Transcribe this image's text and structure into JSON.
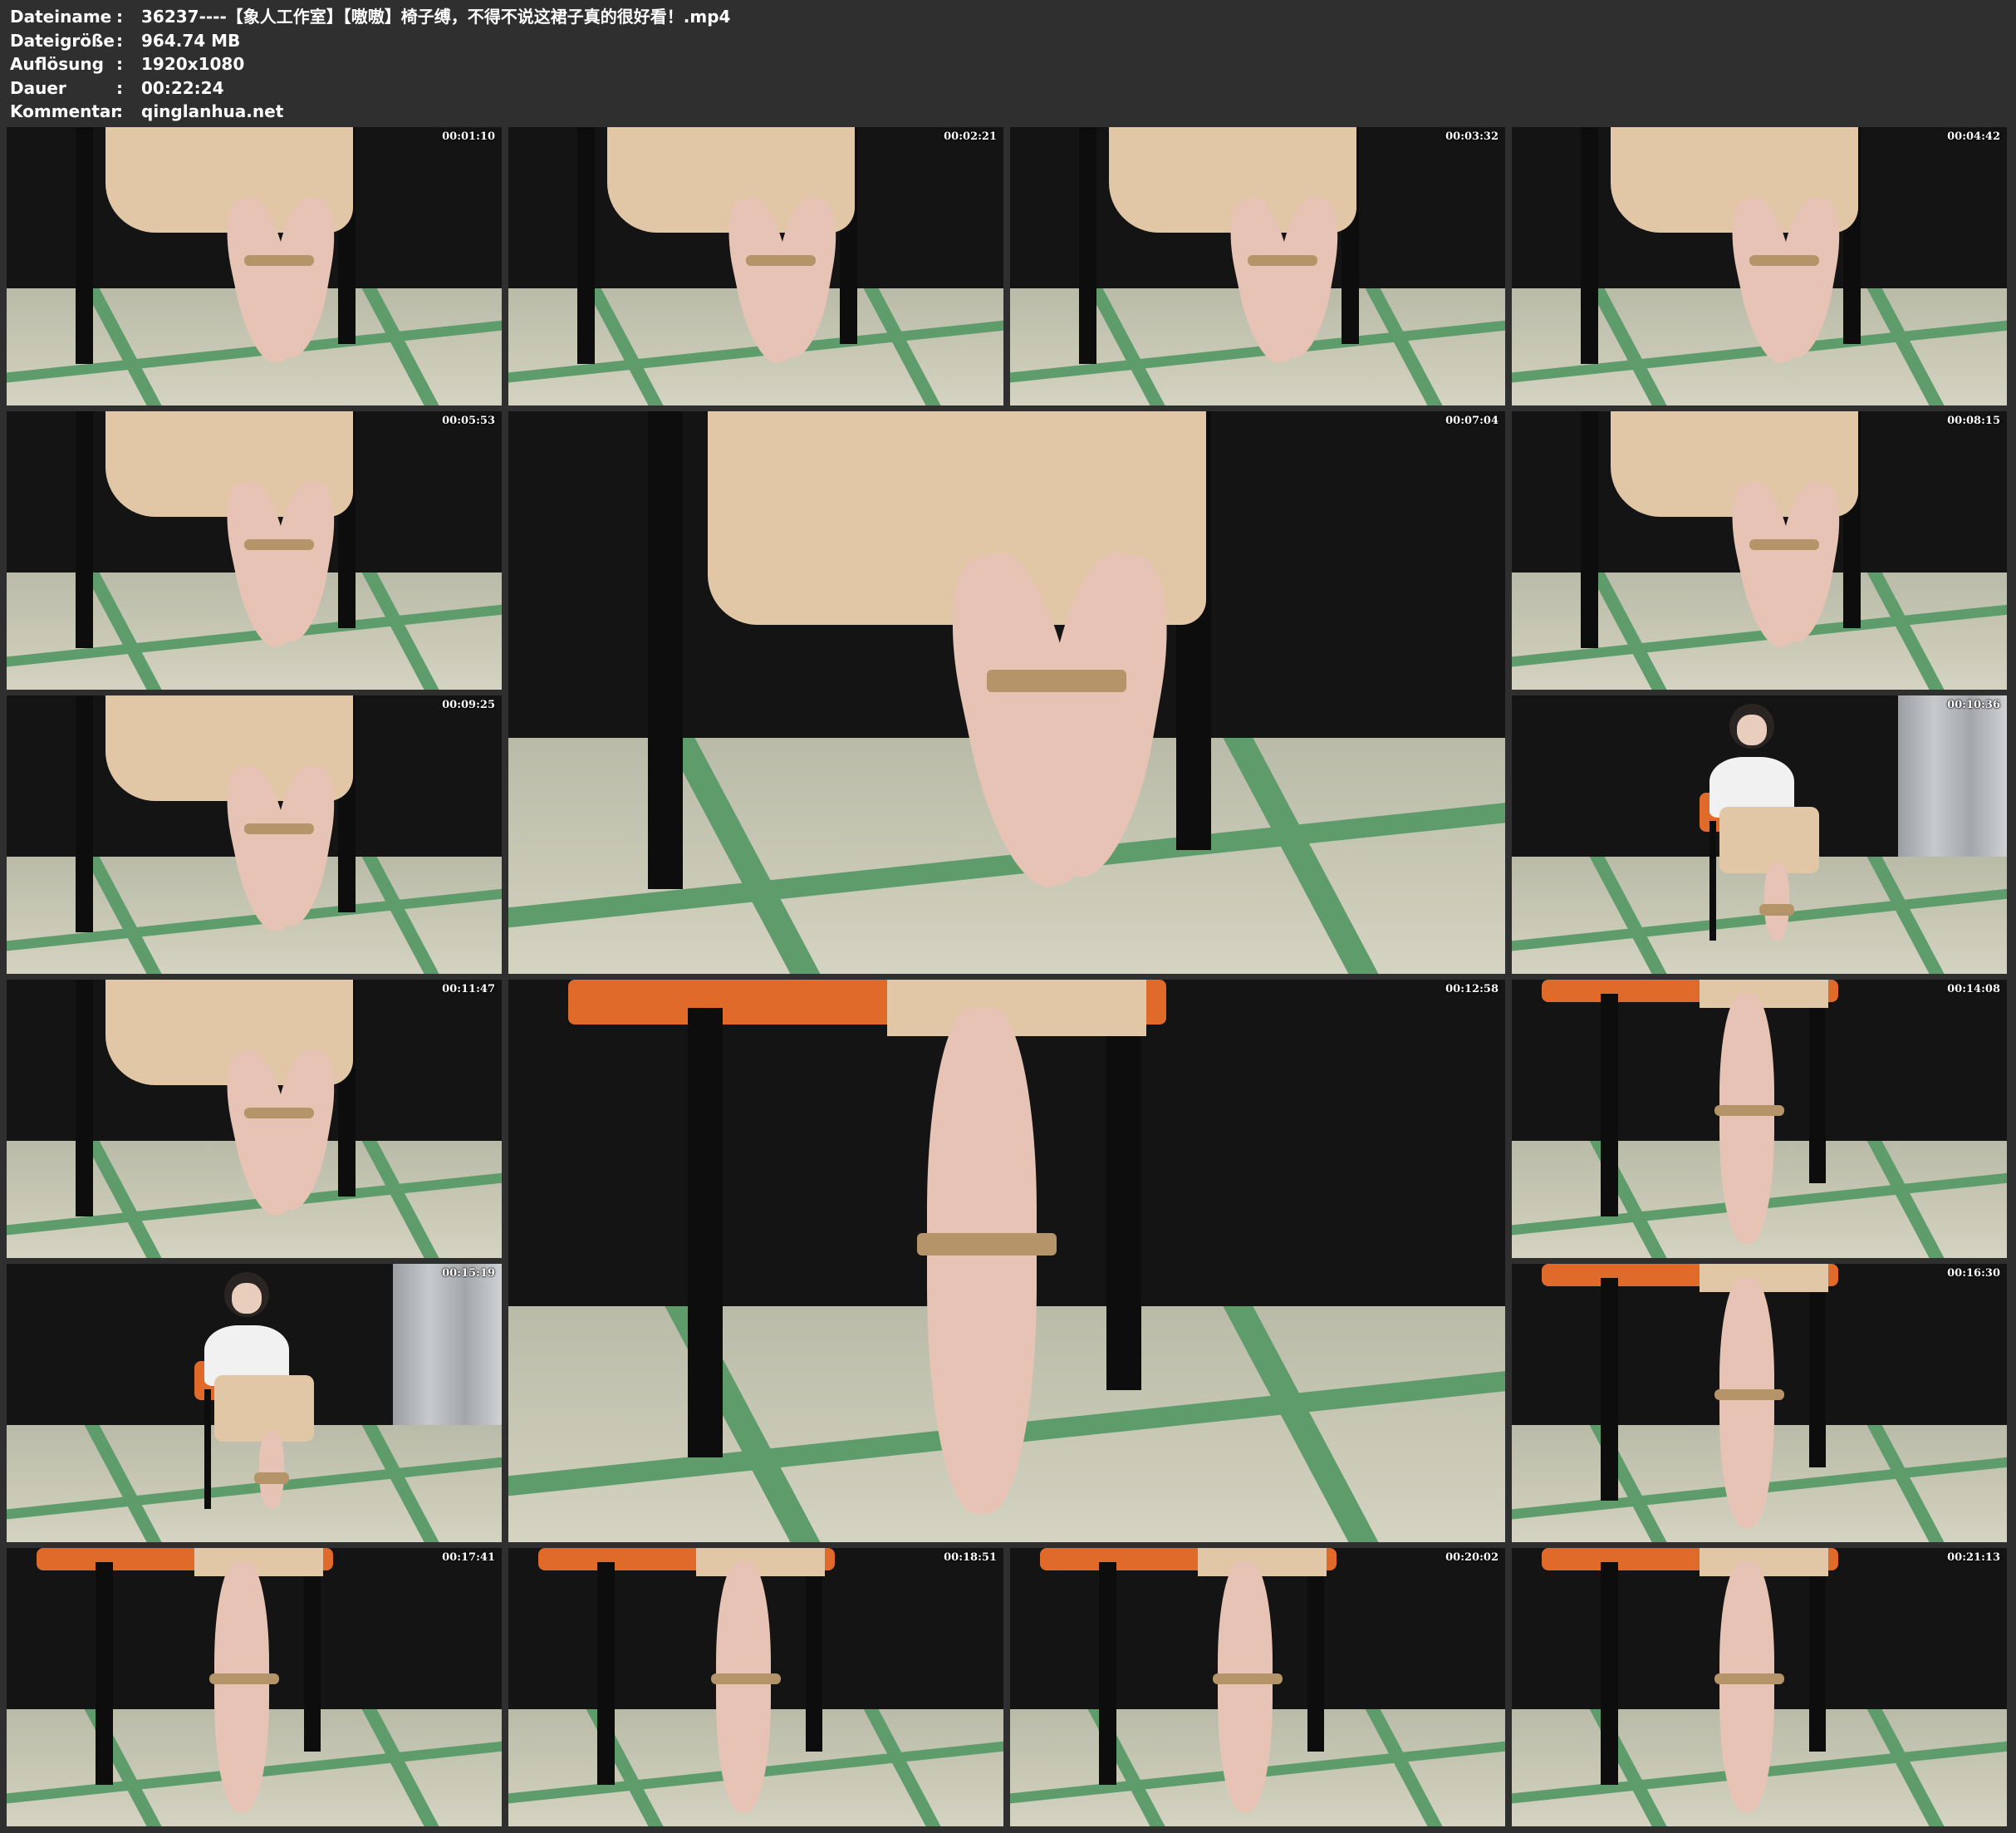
{
  "info": [
    {
      "key": "Dateiname",
      "value": "36237----【象人工作室】【嗷嗷】椅子缚，不得不说这裙子真的很好看！.mp4"
    },
    {
      "key": "Dateigröße",
      "value": "964.74 MB"
    },
    {
      "key": "Auflösung",
      "value": "1920x1080"
    },
    {
      "key": "Dauer",
      "value": "00:22:24"
    },
    {
      "key": "Kommentar",
      "value": "qinglanhua.net"
    }
  ],
  "separator": ":",
  "thumbnails": [
    {
      "timestamp": "00:01:10",
      "scene": "feet-closeup"
    },
    {
      "timestamp": "00:02:21",
      "scene": "feet-closeup"
    },
    {
      "timestamp": "00:03:32",
      "scene": "feet-closeup"
    },
    {
      "timestamp": "00:04:42",
      "scene": "feet-closeup"
    },
    {
      "timestamp": "00:05:53",
      "scene": "feet-closeup"
    },
    {
      "timestamp": "00:07:04",
      "scene": "feet-closeup-large"
    },
    {
      "timestamp": "00:08:15",
      "scene": "feet-closeup"
    },
    {
      "timestamp": "00:09:25",
      "scene": "feet-closeup"
    },
    {
      "timestamp": "00:10:36",
      "scene": "full-body"
    },
    {
      "timestamp": "00:11:47",
      "scene": "feet-closeup"
    },
    {
      "timestamp": "00:12:58",
      "scene": "leg-standing-large"
    },
    {
      "timestamp": "00:14:08",
      "scene": "leg-standing"
    },
    {
      "timestamp": "00:15:19",
      "scene": "full-body"
    },
    {
      "timestamp": "00:16:30",
      "scene": "leg-standing"
    },
    {
      "timestamp": "00:17:41",
      "scene": "leg-standing"
    },
    {
      "timestamp": "00:18:51",
      "scene": "leg-standing"
    },
    {
      "timestamp": "00:20:02",
      "scene": "leg-standing"
    },
    {
      "timestamp": "00:21:13",
      "scene": "leg-standing"
    }
  ]
}
